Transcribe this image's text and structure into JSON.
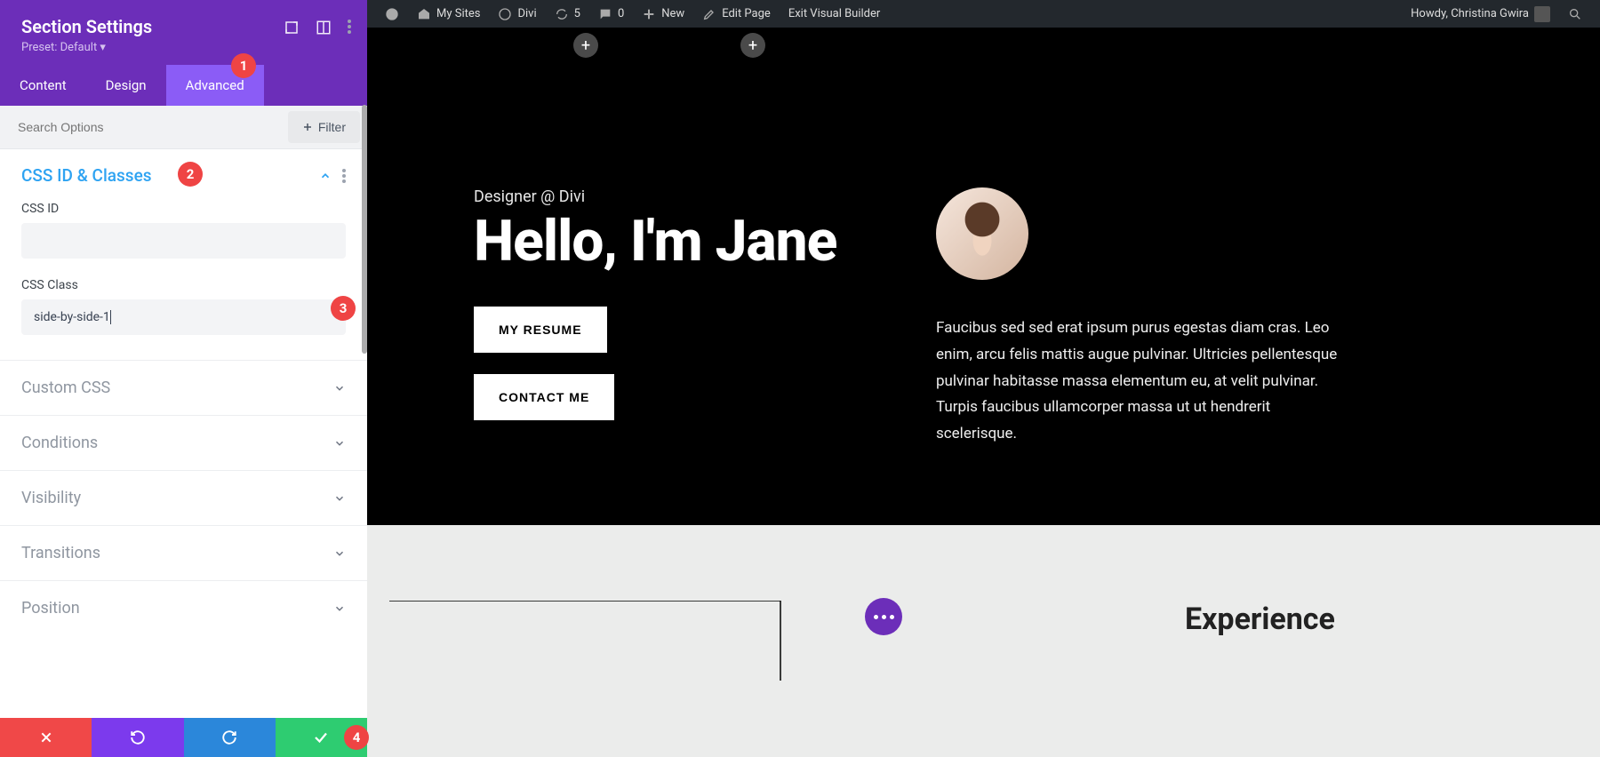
{
  "sidebar": {
    "title": "Section Settings",
    "preset": "Preset: Default ▾",
    "tabs": {
      "content": "Content",
      "design": "Design",
      "advanced": "Advanced"
    },
    "search_placeholder": "Search Options",
    "filter_label": "Filter",
    "section_open": "CSS ID & Classes",
    "css_id_label": "CSS ID",
    "css_id_value": "",
    "css_class_label": "CSS Class",
    "css_class_value": "side-by-side-1",
    "accordions": [
      "Custom CSS",
      "Conditions",
      "Visibility",
      "Transitions",
      "Position"
    ]
  },
  "badges": {
    "b1": "1",
    "b2": "2",
    "b3": "3",
    "b4": "4"
  },
  "admin_bar": {
    "my_sites": "My Sites",
    "site_name": "Divi",
    "updates": "5",
    "comments": "0",
    "new": "New",
    "edit_page": "Edit Page",
    "exit_vb": "Exit Visual Builder",
    "howdy": "Howdy, Christina Gwira"
  },
  "hero": {
    "subtitle": "Designer @ Divi",
    "title": "Hello, I'm Jane",
    "btn_resume": "MY RESUME",
    "btn_contact": "CONTACT ME",
    "desc": "Faucibus sed sed erat ipsum purus egestas diam cras. Leo enim, arcu felis mattis augue pulvinar. Ultricies pellentesque pulvinar habitasse massa elementum eu, at velit pulvinar. Turpis faucibus ullamcorper massa ut ut hendrerit scelerisque."
  },
  "experience": {
    "title": "Experience"
  }
}
